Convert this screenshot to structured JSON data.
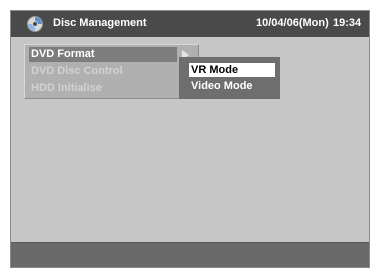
{
  "header": {
    "icon": "disc-icon",
    "title": "Disc Management",
    "date": "10/04/06(Mon)",
    "time": "19:34"
  },
  "main_menu": {
    "items": [
      {
        "label": "DVD Format",
        "state": "selected"
      },
      {
        "label": "DVD Disc Control",
        "state": "disabled"
      },
      {
        "label": "HDD Initialise",
        "state": "disabled"
      }
    ],
    "submenu_arrow_icon": "arrow-right-icon"
  },
  "sub_menu": {
    "items": [
      {
        "label": "VR Mode",
        "state": "selected"
      },
      {
        "label": "Video Mode",
        "state": "normal"
      }
    ]
  },
  "status_bar": {
    "text": ""
  },
  "colors": {
    "background": "#c6c6c6",
    "header": "#4a4a4a",
    "menu_selected": "#7d7d7d",
    "submenu_bg": "#6e6e6e",
    "status_bar": "#6a6a6a"
  }
}
